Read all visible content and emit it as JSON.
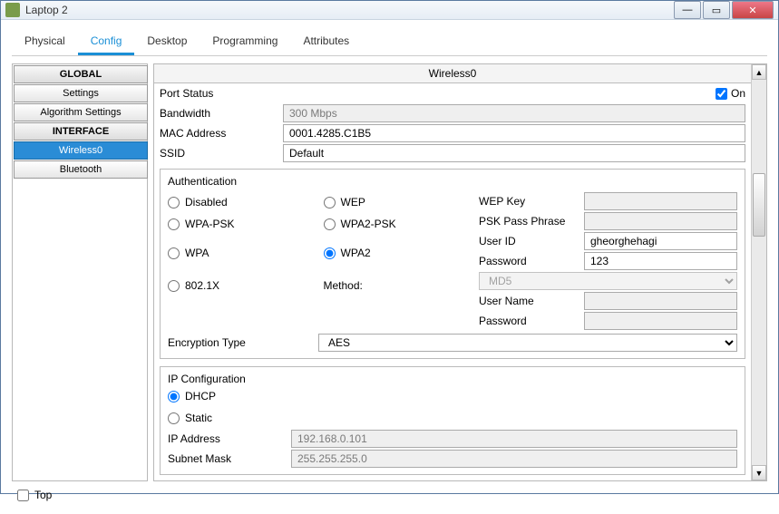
{
  "window": {
    "title": "Laptop 2"
  },
  "tabs": [
    "Physical",
    "Config",
    "Desktop",
    "Programming",
    "Attributes"
  ],
  "activeTab": "Config",
  "sidebar": {
    "globalHdr": "GLOBAL",
    "settings": "Settings",
    "algoSettings": "Algorithm Settings",
    "interfaceHdr": "INTERFACE",
    "wireless0": "Wireless0",
    "bluetooth": "Bluetooth"
  },
  "panelTitle": "Wireless0",
  "portStatus": {
    "label": "Port Status",
    "onLabel": "On",
    "checked": true
  },
  "bandwidth": {
    "label": "Bandwidth",
    "value": "300 Mbps"
  },
  "mac": {
    "label": "MAC Address",
    "value": "0001.4285.C1B5"
  },
  "ssid": {
    "label": "SSID",
    "value": "Default"
  },
  "auth": {
    "title": "Authentication",
    "disabled": "Disabled",
    "wep": "WEP",
    "wpapsk": "WPA-PSK",
    "wpa2psk": "WPA2-PSK",
    "wpa": "WPA",
    "wpa2": "WPA2",
    "dot1x": "802.1X",
    "methodLabel": "Method:",
    "selected": "WPA2",
    "wepKeyLabel": "WEP Key",
    "pskLabel": "PSK Pass Phrase",
    "userIdLabel": "User ID",
    "userId": "gheorghehagi",
    "passwordLabel": "Password",
    "password": "123",
    "methodValue": "MD5",
    "userNameLabel": "User Name",
    "userName": "",
    "password2Label": "Password",
    "password2": ""
  },
  "encType": {
    "label": "Encryption Type",
    "value": "AES"
  },
  "ip": {
    "title": "IP Configuration",
    "dhcp": "DHCP",
    "static": "Static",
    "selected": "DHCP",
    "ipLabel": "IP Address",
    "ip": "192.168.0.101",
    "maskLabel": "Subnet Mask",
    "mask": "255.255.255.0"
  },
  "footer": {
    "topLabel": "Top"
  }
}
